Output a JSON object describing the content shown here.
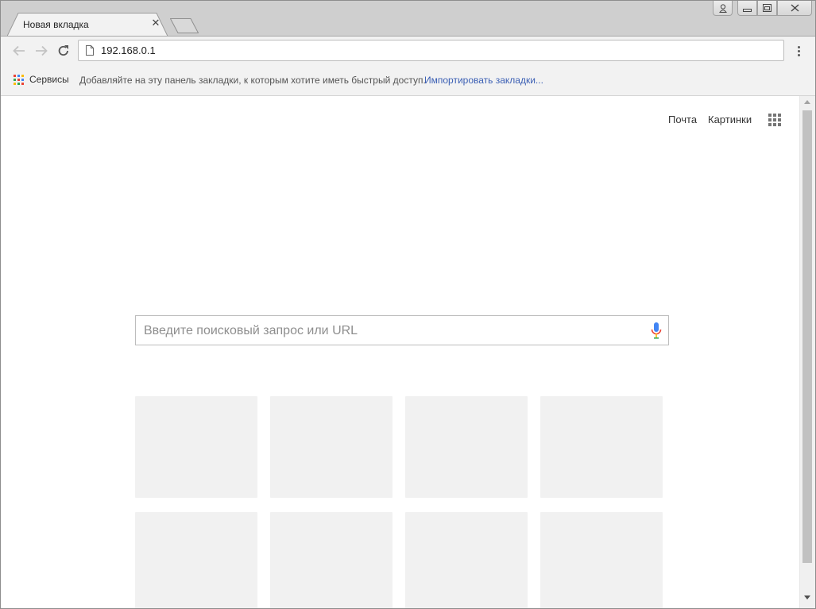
{
  "tab": {
    "title": "Новая вкладка",
    "close_glyph": "✕"
  },
  "window_controls": [
    "profile-icon",
    "minimize-icon",
    "restore-icon",
    "close-icon"
  ],
  "toolbar": {
    "address": "192.168.0.1",
    "icons": [
      "back-arrow-icon",
      "forward-arrow-icon",
      "reload-icon",
      "page-icon",
      "menu-dots-icon"
    ]
  },
  "bookmarks_bar": {
    "apps_label": "Сервисы",
    "hint": "Добавляйте на эту панель закладки, к которым хотите иметь быстрый доступ.",
    "import_link": "Импортировать закладки..."
  },
  "google_header": {
    "mail": "Почта",
    "images": "Картинки",
    "apps_icon": "apps-grid-icon"
  },
  "search": {
    "placeholder": "Введите поисковый запрос или URL",
    "mic_icon": "microphone-icon"
  },
  "colors": {
    "apps_grid": [
      "#ea4335",
      "#4285f4",
      "#fbbc05",
      "#34a853",
      "#ea4335",
      "#4285f4",
      "#fbbc05",
      "#34a853",
      "#ea4335"
    ],
    "link": "#3b5fb4",
    "tile": "#f1f1f1",
    "mic_blue": "#4285f4",
    "mic_red": "#ea4335"
  },
  "most_visited_tiles": 8
}
